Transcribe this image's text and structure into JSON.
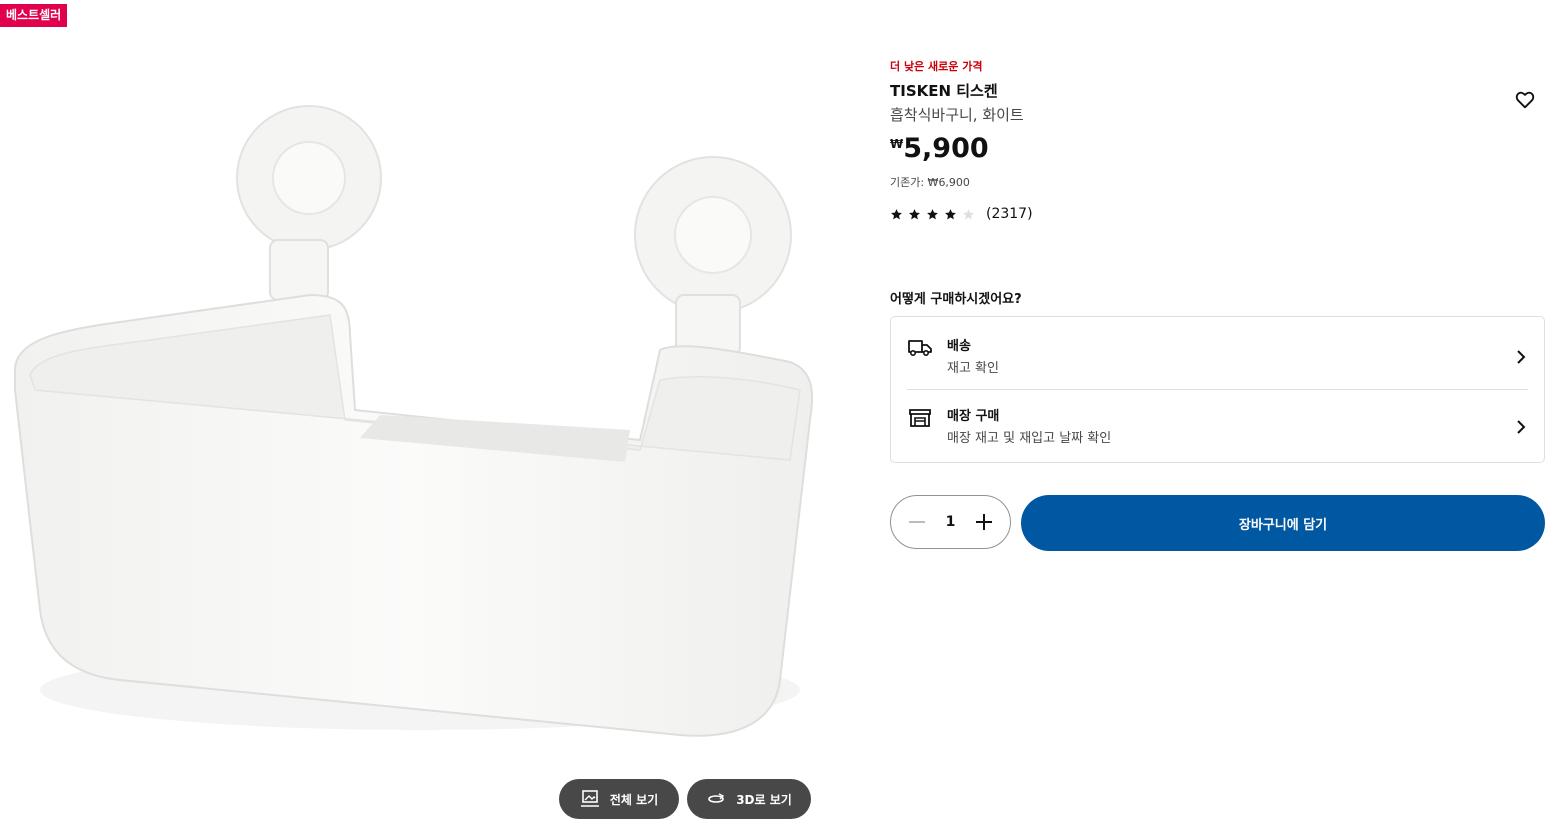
{
  "badge": "베스트셀러",
  "image_buttons": {
    "full_view": "전체 보기",
    "view_3d": "3D로 보기"
  },
  "product": {
    "promo": "더 낮은 새로운 가격",
    "name": "TISKEN 티스켄",
    "description": "흡착식바구니, 화이트",
    "currency": "₩",
    "price": "5,900",
    "original_price": "기존가: ₩6,900",
    "rating": 4,
    "rating_max": 5,
    "review_count": "(2317)"
  },
  "purchase": {
    "heading": "어떻게 구매하시겠어요?",
    "options": [
      {
        "title": "배송",
        "subtitle": "재고 확인",
        "icon": "truck-icon"
      },
      {
        "title": "매장 구매",
        "subtitle": "매장 재고 및 재입고 날짜 확인",
        "icon": "store-icon"
      }
    ],
    "quantity": "1",
    "add_to_cart": "장바구니에 담기"
  },
  "colors": {
    "badge": "#e0004d",
    "promo": "#cc0008",
    "primary": "#0058a3",
    "dark_button": "#484848"
  }
}
